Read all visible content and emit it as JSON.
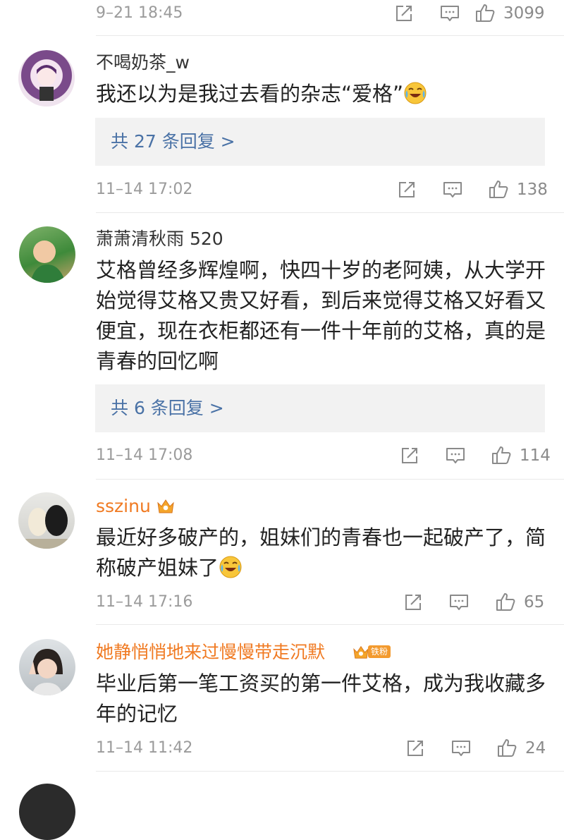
{
  "colors": {
    "vip_name": "#f07a22",
    "reply_link": "#4a72a6",
    "meta": "#9b9b9b",
    "reply_bg": "#f2f2f2"
  },
  "top_meta": {
    "date": "9–21 18:45",
    "likes": "3099"
  },
  "comments": [
    {
      "user": "不喝奶茶_w",
      "text": "我还以为是我过去看的杂志“爱格”",
      "emoji": "laughing-crying-emoji",
      "reply": "共 27 条回复 >",
      "date": "11–14 17:02",
      "likes": "138"
    },
    {
      "user": "萧萧清秋雨 520",
      "text": "艾格曾经多辉煌啊，快四十岁的老阿姨，从大学开始觉得艾格又贵又好看，到后来觉得艾格又好看又便宜，现在衣柜都还有一件十年前的艾格，真的是青春的回忆啊",
      "reply": "共 6 条回复 >",
      "date": "11–14 17:08",
      "likes": "114"
    },
    {
      "user": "sszinu",
      "badge": "crown-badge",
      "text": "最近好多破产的，姐妹们的青春也一起破产了，简称破产姐妹了",
      "emoji": "laughing-crying-emoji",
      "date": "11–14 17:16",
      "likes": "65"
    },
    {
      "user": "她静悄悄地来过慢慢带走沉默",
      "badge_text": "铁粉",
      "text": "毕业后第一笔工资买的第一件艾格，成为我收藏多年的记忆",
      "date": "11–14 11:42",
      "likes": "24"
    }
  ]
}
